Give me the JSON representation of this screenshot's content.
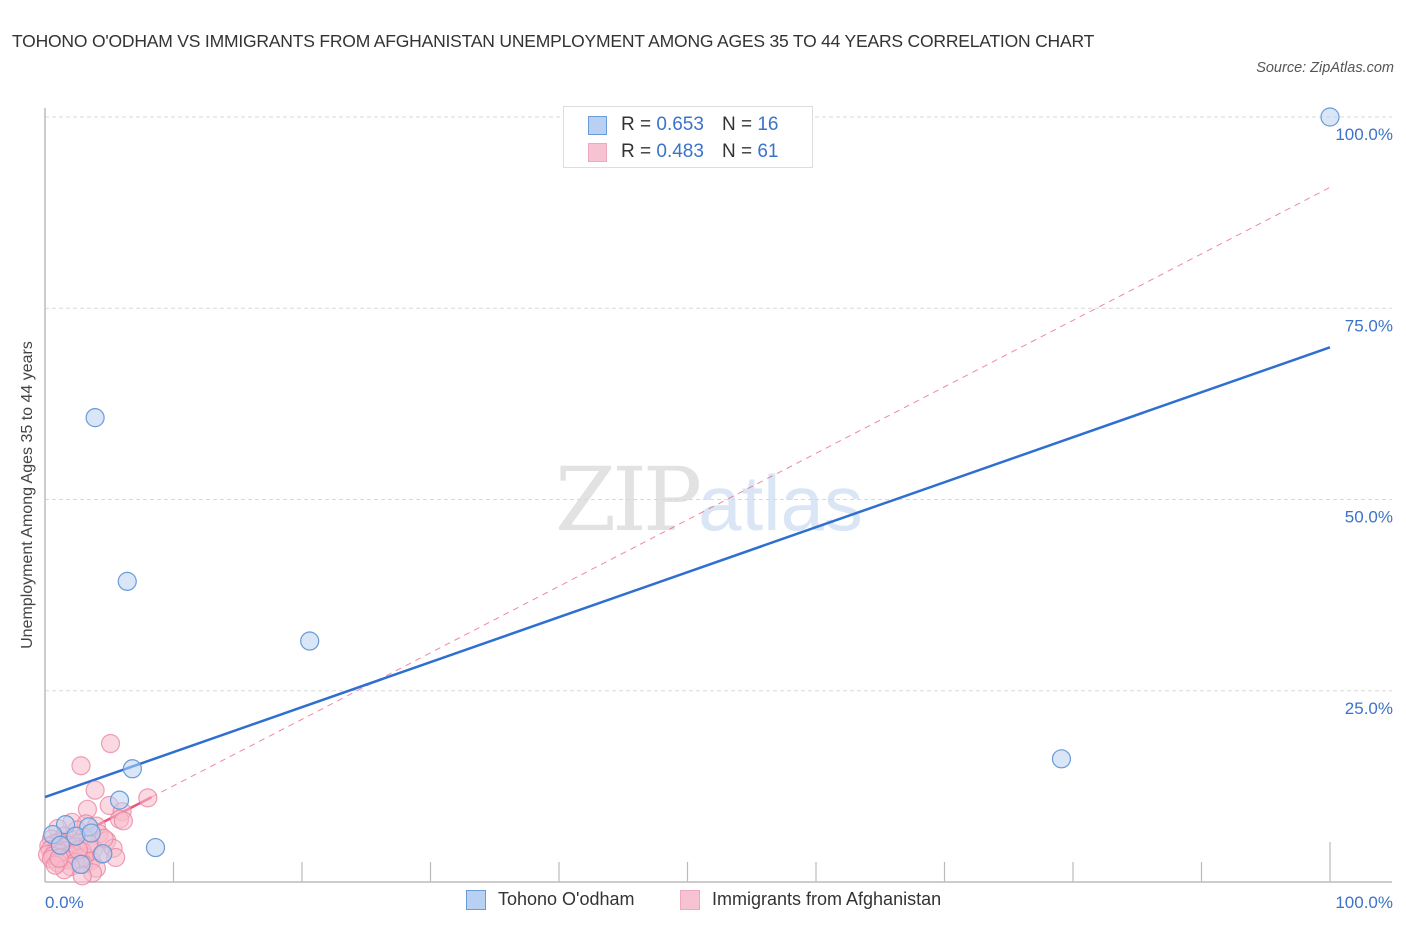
{
  "header": {
    "title": "TOHONO O'ODHAM VS IMMIGRANTS FROM AFGHANISTAN UNEMPLOYMENT AMONG AGES 35 TO 44 YEARS CORRELATION CHART",
    "source": "Source: ZipAtlas.com"
  },
  "watermark": {
    "zip": "ZIP",
    "atlas": "atlas"
  },
  "legend_top": [
    {
      "r_label": "R = ",
      "r_value": "0.653",
      "n_label": "N = ",
      "n_value": "16"
    },
    {
      "r_label": "R = ",
      "r_value": "0.483",
      "n_label": "N = ",
      "n_value": "61"
    }
  ],
  "colors": {
    "blue_fill": "#b8d1f3",
    "blue_stroke": "#6a9ad8",
    "blue_line": "#2f6fd0",
    "pink_fill": "#f7b9cb",
    "pink_stroke": "#e8829f",
    "pink_line": "#e8557f",
    "tick_text": "#3b73c9",
    "grid": "#d8d8d8",
    "axis": "#bbbbbb"
  },
  "chart_data": {
    "type": "scatter",
    "title": "TOHONO O'ODHAM VS IMMIGRANTS FROM AFGHANISTAN UNEMPLOYMENT AMONG AGES 35 TO 44 YEARS CORRELATION CHART",
    "xlabel": "",
    "ylabel": "Unemployment Among Ages 35 to 44 years",
    "xlim": [
      0,
      100
    ],
    "ylim": [
      0,
      100
    ],
    "x_tick_labels": [
      "0.0%",
      "100.0%"
    ],
    "y_tick_labels": [
      "100.0%",
      "75.0%",
      "50.0%",
      "25.0%"
    ],
    "y_ticks": [
      100,
      75,
      50,
      25
    ],
    "x_minor_ticks": [
      10,
      20,
      30,
      40,
      50,
      60,
      70,
      80,
      90,
      100
    ],
    "grid": true,
    "legend_position": "bottom",
    "series": [
      {
        "name": "Tohono O'odham",
        "color": "#6a9ad8",
        "R": 0.653,
        "N": 16,
        "trend": {
          "x": [
            0,
            100
          ],
          "y": [
            11.1,
            69.9
          ],
          "style": "solid"
        },
        "points": [
          [
            100,
            100
          ],
          [
            3.9,
            60.7
          ],
          [
            6.4,
            39.3
          ],
          [
            20.6,
            31.5
          ],
          [
            79.1,
            16.1
          ],
          [
            6.8,
            14.8
          ],
          [
            5.8,
            10.7
          ],
          [
            8.6,
            4.5
          ],
          [
            1.6,
            7.5
          ],
          [
            3.4,
            7.2
          ],
          [
            0.6,
            6.2
          ],
          [
            2.4,
            6.0
          ],
          [
            3.6,
            6.4
          ],
          [
            4.5,
            3.7
          ],
          [
            2.8,
            2.3
          ],
          [
            1.2,
            4.8
          ]
        ]
      },
      {
        "name": "Immigrants from Afghanistan",
        "color": "#e8829f",
        "R": 0.483,
        "N": 61,
        "trend": {
          "x": [
            0,
            8.3
          ],
          "y": [
            3.9,
            11.1
          ],
          "style": "solid"
        },
        "trend_extended": {
          "x": [
            8.3,
            100
          ],
          "y": [
            11.1,
            90.8
          ],
          "style": "dashed"
        },
        "points": [
          [
            5.1,
            18.1
          ],
          [
            2.8,
            15.2
          ],
          [
            3.9,
            12.0
          ],
          [
            8.0,
            11.0
          ],
          [
            5.0,
            10.0
          ],
          [
            3.3,
            9.5
          ],
          [
            6.0,
            9.2
          ],
          [
            5.8,
            8.2
          ],
          [
            6.1,
            8.0
          ],
          [
            2.1,
            7.8
          ],
          [
            3.2,
            7.6
          ],
          [
            4.0,
            7.3
          ],
          [
            1.0,
            7.0
          ],
          [
            2.5,
            6.8
          ],
          [
            4.2,
            6.3
          ],
          [
            1.5,
            6.0
          ],
          [
            3.0,
            5.8
          ],
          [
            0.5,
            5.6
          ],
          [
            2.0,
            5.5
          ],
          [
            4.8,
            5.4
          ],
          [
            1.1,
            5.2
          ],
          [
            2.6,
            5.1
          ],
          [
            0.7,
            5.0
          ],
          [
            3.5,
            4.9
          ],
          [
            1.8,
            4.8
          ],
          [
            0.3,
            4.7
          ],
          [
            2.3,
            4.6
          ],
          [
            1.4,
            4.5
          ],
          [
            0.9,
            4.4
          ],
          [
            3.8,
            4.3
          ],
          [
            0.4,
            4.2
          ],
          [
            1.6,
            4.1
          ],
          [
            2.9,
            4.0
          ],
          [
            0.8,
            3.9
          ],
          [
            1.2,
            3.8
          ],
          [
            2.2,
            3.7
          ],
          [
            0.2,
            3.6
          ],
          [
            1.9,
            3.5
          ],
          [
            0.6,
            3.4
          ],
          [
            3.1,
            3.3
          ],
          [
            1.3,
            3.2
          ],
          [
            2.7,
            3.1
          ],
          [
            0.5,
            3.0
          ],
          [
            1.7,
            2.9
          ],
          [
            3.6,
            2.8
          ],
          [
            4.4,
            3.6
          ],
          [
            5.3,
            4.4
          ],
          [
            2.4,
            2.6
          ],
          [
            3.0,
            2.3
          ],
          [
            5.5,
            3.2
          ],
          [
            2.0,
            2.0
          ],
          [
            1.0,
            2.5
          ],
          [
            4.0,
            1.8
          ],
          [
            3.7,
            1.2
          ],
          [
            2.9,
            0.8
          ],
          [
            1.5,
            1.6
          ],
          [
            0.8,
            2.2
          ],
          [
            4.6,
            5.7
          ],
          [
            3.4,
            5.0
          ],
          [
            2.6,
            4.2
          ],
          [
            1.1,
            3.1
          ]
        ]
      }
    ]
  },
  "legend_bottom": [
    {
      "label": "Tohono O'odham"
    },
    {
      "label": "Immigrants from Afghanistan"
    }
  ]
}
